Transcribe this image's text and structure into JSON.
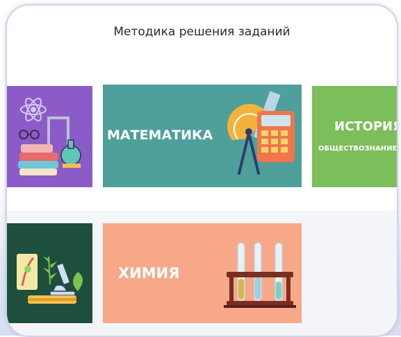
{
  "page": {
    "title": "Методика решения заданий"
  },
  "tiles": {
    "physics": {
      "color": "#8b5cc7"
    },
    "math": {
      "label": "МАТЕМАТИКА",
      "color": "#4f9f9b"
    },
    "history": {
      "label": "ИСТОРИЯ",
      "sublabel": "ОБЩЕСТВОЗНАНИЕ",
      "color": "#7bbe5a"
    },
    "biology": {
      "color": "#1e4e3c"
    },
    "chemistry": {
      "label": "ХИМИЯ",
      "color": "#f6a889"
    }
  },
  "icons": {
    "physics": "atom-books-lab-icon",
    "math": "calculator-protractor-compass-icon",
    "biology": "microscope-plant-icon",
    "chemistry": "test-tubes-rack-icon"
  }
}
